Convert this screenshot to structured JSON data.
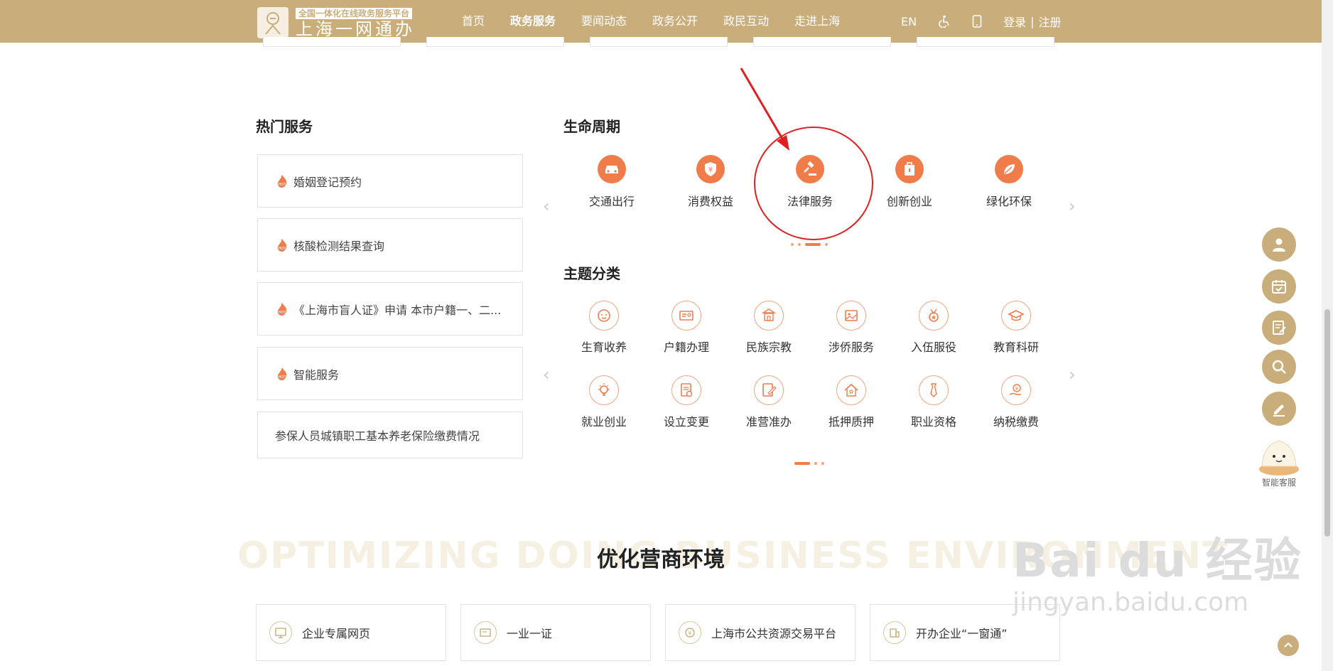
{
  "header": {
    "logo_tag": "全国一体化在线政务服务平台",
    "logo_name": "上海一网通办",
    "nav": [
      {
        "label": "首页",
        "active": false
      },
      {
        "label": "政务服务",
        "active": true
      },
      {
        "label": "要闻动态",
        "active": false
      },
      {
        "label": "政务公开",
        "active": false
      },
      {
        "label": "政民互动",
        "active": false
      },
      {
        "label": "走进上海",
        "active": false
      }
    ],
    "lang": "EN",
    "accessibility_icon": "accessibility-icon",
    "mobile_icon": "mobile-phone-icon",
    "login": "登录",
    "separator": "|",
    "register": "注册",
    "brand_color": "#c9ae7c"
  },
  "hot_services": {
    "title": "热门服务",
    "items": [
      {
        "label": "婚姻登记预约",
        "hot": true
      },
      {
        "label": "核酸检测结果查询",
        "hot": true
      },
      {
        "label": "《上海市盲人证》申请 本市户籍一、二...",
        "hot": true
      },
      {
        "label": "智能服务",
        "hot": true
      },
      {
        "label": "参保人员城镇职工基本养老保险缴费情况",
        "hot": false
      }
    ]
  },
  "life_cycle": {
    "title": "生命周期",
    "items": [
      {
        "label": "交通出行",
        "icon": "car-icon"
      },
      {
        "label": "消费权益",
        "icon": "shield-yen-icon"
      },
      {
        "label": "法律服务",
        "icon": "gavel-icon"
      },
      {
        "label": "创新创业",
        "icon": "briefcase-icon"
      },
      {
        "label": "绿化环保",
        "icon": "leaf-icon"
      }
    ],
    "accent_color": "#f07c4a"
  },
  "themes": {
    "title": "主题分类",
    "items": [
      {
        "label": "生育收养",
        "icon": "baby-face-icon"
      },
      {
        "label": "户籍办理",
        "icon": "id-card-icon"
      },
      {
        "label": "民族宗教",
        "icon": "temple-icon"
      },
      {
        "label": "涉侨服务",
        "icon": "overseas-photo-icon"
      },
      {
        "label": "入伍服役",
        "icon": "medal-icon"
      },
      {
        "label": "教育科研",
        "icon": "graduation-cap-icon"
      },
      {
        "label": "就业创业",
        "icon": "lightbulb-icon"
      },
      {
        "label": "设立变更",
        "icon": "document-refresh-icon"
      },
      {
        "label": "准营准办",
        "icon": "edit-document-icon"
      },
      {
        "label": "抵押质押",
        "icon": "house-icon"
      },
      {
        "label": "职业资格",
        "icon": "tie-icon"
      },
      {
        "label": "纳税缴费",
        "icon": "tax-hand-icon"
      }
    ]
  },
  "optimize": {
    "bg_text": "OPTIMIZING DOING BUSINESS ENVIRONMENT",
    "title": "优化营商环境",
    "cards": [
      {
        "label": "企业专属网页",
        "icon": "monitor-icon"
      },
      {
        "label": "一业一证",
        "icon": "certificate-icon"
      },
      {
        "label": "上海市公共资源交易平台",
        "icon": "yen-coin-icon"
      },
      {
        "label": "开办企业“一窗通”",
        "icon": "building-icon"
      }
    ]
  },
  "sidebar": {
    "buttons": [
      "user-icon",
      "calendar-check-icon",
      "edit-note-icon",
      "search-icon",
      "pen-icon"
    ],
    "assistant_label": "智能客服"
  },
  "watermark": {
    "main": "Bai du 经验",
    "sub": "jingyan.baidu.com"
  },
  "annotation_color": "#e02020"
}
